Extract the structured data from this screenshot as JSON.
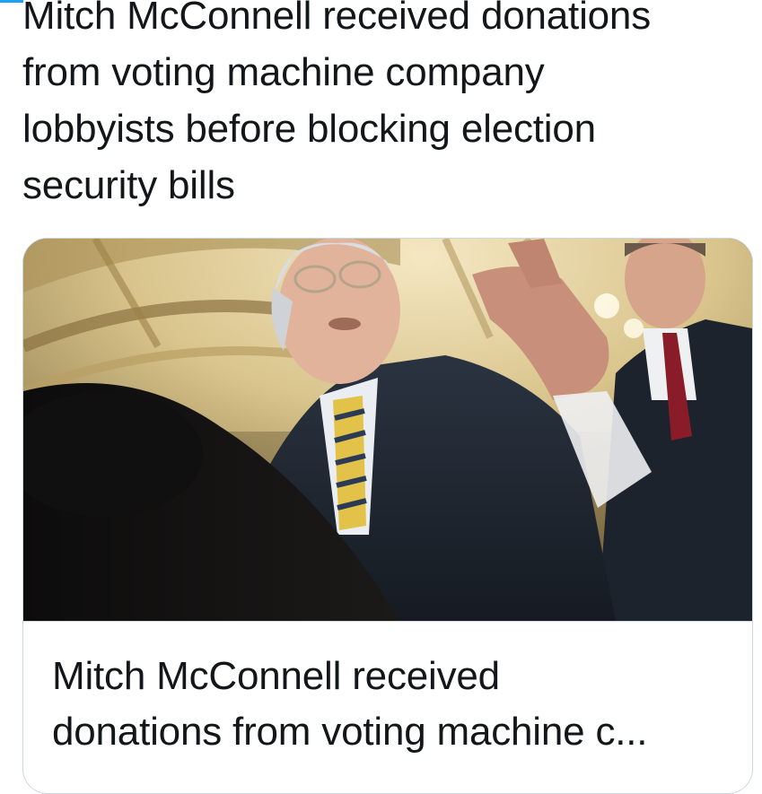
{
  "tweet": {
    "text_lines": [
      "Mitch McConnell received donations",
      "from voting machine company",
      "lobbyists before blocking election",
      "security bills"
    ]
  },
  "card": {
    "image_icon": "news-photo",
    "title_lines": [
      "Mitch McConnell received",
      "donations from voting machine c..."
    ]
  },
  "colors": {
    "accent": "#1da1f2",
    "border": "#ccd6dd",
    "text": "#14171a"
  }
}
